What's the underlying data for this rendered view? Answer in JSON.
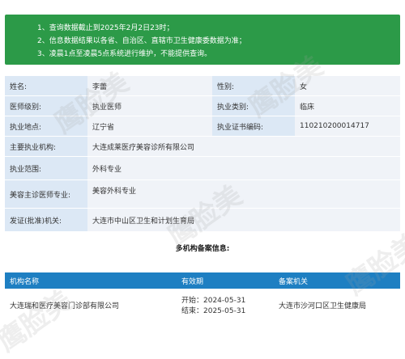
{
  "notice": {
    "lines": [
      "1、查询数据截止到2025年2月2日23时；",
      "2、信息数据结果以各省、自治区、直辖市卫生健康委数据为准；",
      "3、凌晨1点至凌晨5点系统进行维护，不能提供查询。"
    ]
  },
  "info": {
    "name_label": "姓名:",
    "name_value": "李蕾",
    "gender_label": "性别:",
    "gender_value": "女",
    "level_label": "医师级别:",
    "level_value": "执业医师",
    "category_label": "执业类别:",
    "category_value": "临床",
    "location_label": "执业地点:",
    "location_value": "辽宁省",
    "cert_label": "执业证书编码:",
    "cert_value": "110210200014717",
    "org_label": "主要执业机构:",
    "org_value": "大连成莱医疗美容诊所有限公司",
    "scope_label": "执业范围:",
    "scope_value": "外科专业",
    "cosmetic_label": "美容主诊医师专业:",
    "cosmetic_value": "美容外科专业",
    "issuer_label": "发证(批准)机关:",
    "issuer_value": "大连市中山区卫生和计划生育局"
  },
  "multi": {
    "title": "多机构备案信息:",
    "headers": [
      "机构名称",
      "有效期",
      "备案机关"
    ],
    "row": {
      "org": "大连瑞和医疗美容门诊部有限公司",
      "start": "开始：2024-05-31",
      "end": "结束：2025-05-31",
      "agency": "大连市沙河口区卫生健康局"
    }
  },
  "watermark": "鹰脸美"
}
